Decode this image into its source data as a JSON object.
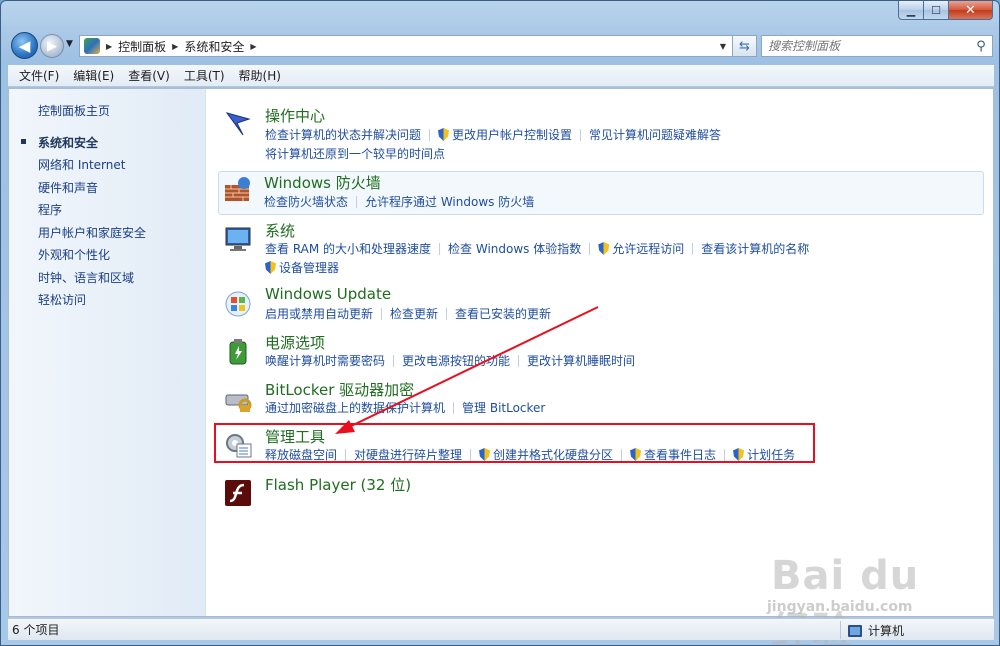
{
  "window": {
    "minimize_label": "▁",
    "maximize_label": "☐",
    "close_label": "✕"
  },
  "address_bar": {
    "crumbs": [
      "控制面板",
      "系统和安全"
    ],
    "search_placeholder": "搜索控制面板"
  },
  "menu": [
    "文件(F)",
    "编辑(E)",
    "查看(V)",
    "工具(T)",
    "帮助(H)"
  ],
  "sidebar": {
    "home": "控制面板主页",
    "items": [
      "系统和安全",
      "网络和 Internet",
      "硬件和声音",
      "程序",
      "用户帐户和家庭安全",
      "外观和个性化",
      "时钟、语言和区域",
      "轻松访问"
    ]
  },
  "categories": [
    {
      "title": "操作中心",
      "icon": "flag-icon",
      "lines": [
        [
          {
            "label": "检查计算机的状态并解决问题",
            "shield": false
          },
          {
            "label": "更改用户帐户控制设置",
            "shield": true
          },
          {
            "label": "常见计算机问题疑难解答",
            "shield": false
          }
        ],
        [
          {
            "label": "将计算机还原到一个较早的时间点",
            "shield": false
          }
        ]
      ]
    },
    {
      "title": "Windows 防火墙",
      "icon": "firewall-icon",
      "lines": [
        [
          {
            "label": "检查防火墙状态",
            "shield": false
          },
          {
            "label": "允许程序通过 Windows 防火墙",
            "shield": false
          }
        ]
      ]
    },
    {
      "title": "系统",
      "icon": "computer-icon",
      "lines": [
        [
          {
            "label": "查看 RAM 的大小和处理器速度",
            "shield": false
          },
          {
            "label": "检查 Windows 体验指数",
            "shield": false
          },
          {
            "label": "允许远程访问",
            "shield": true
          },
          {
            "label": "查看该计算机的名称",
            "shield": false
          }
        ],
        [
          {
            "label": "设备管理器",
            "shield": true
          }
        ]
      ]
    },
    {
      "title": "Windows Update",
      "icon": "windows-update-icon",
      "lines": [
        [
          {
            "label": "启用或禁用自动更新",
            "shield": false
          },
          {
            "label": "检查更新",
            "shield": false
          },
          {
            "label": "查看已安装的更新",
            "shield": false
          }
        ]
      ]
    },
    {
      "title": "电源选项",
      "icon": "battery-icon",
      "lines": [
        [
          {
            "label": "唤醒计算机时需要密码",
            "shield": false
          },
          {
            "label": "更改电源按钮的功能",
            "shield": false
          },
          {
            "label": "更改计算机睡眠时间",
            "shield": false
          }
        ]
      ]
    },
    {
      "title": "BitLocker 驱动器加密",
      "icon": "bitlocker-icon",
      "lines": [
        [
          {
            "label": "通过加密磁盘上的数据保护计算机",
            "shield": false
          },
          {
            "label": "管理 BitLocker",
            "shield": false
          }
        ]
      ]
    },
    {
      "title": "管理工具",
      "icon": "admin-tools-icon",
      "lines": [
        [
          {
            "label": "释放磁盘空间",
            "shield": false
          },
          {
            "label": "对硬盘进行碎片整理",
            "shield": false
          },
          {
            "label": "创建并格式化硬盘分区",
            "shield": true
          },
          {
            "label": "查看事件日志",
            "shield": true
          },
          {
            "label": "计划任务",
            "shield": true
          }
        ]
      ]
    },
    {
      "title": "Flash Player (32 位)",
      "icon": "flash-player-icon",
      "lines": []
    }
  ],
  "statusbar": {
    "item_count": "6 个项目",
    "location": "计算机"
  },
  "watermark": {
    "logo": "Bai du 经验",
    "url": "jingyan.baidu.com"
  },
  "colors": {
    "accent_highlight": "#e8101f",
    "title_green": "#1f6d1f",
    "link_blue": "#1e4d9e"
  }
}
